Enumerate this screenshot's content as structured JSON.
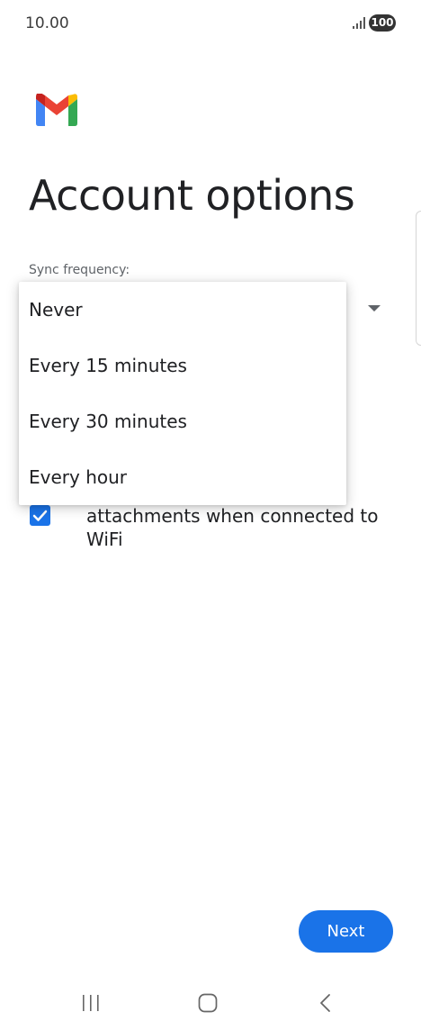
{
  "status_bar": {
    "time": "10.00",
    "battery": "100",
    "signal_icon": "signal-bars-icon"
  },
  "app": {
    "logo": "gmail-logo",
    "colors": {
      "accent": "#1a73e8",
      "gmail_red": "#ea4335",
      "gmail_blue": "#4285f4",
      "gmail_green": "#34a853",
      "gmail_yellow": "#fbbc04"
    }
  },
  "page": {
    "title": "Account options",
    "sync_label": "Sync frequency:",
    "checkbox": {
      "checked": true,
      "text_visible": "attachments when connected to WiFi"
    }
  },
  "dropdown": {
    "options": [
      "Never",
      "Every 15 minutes",
      "Every 30 minutes",
      "Every hour"
    ]
  },
  "footer": {
    "next_label": "Next"
  },
  "nav_bar": {
    "recents_icon": "recents-icon",
    "home_icon": "home-icon",
    "back_icon": "back-icon"
  }
}
